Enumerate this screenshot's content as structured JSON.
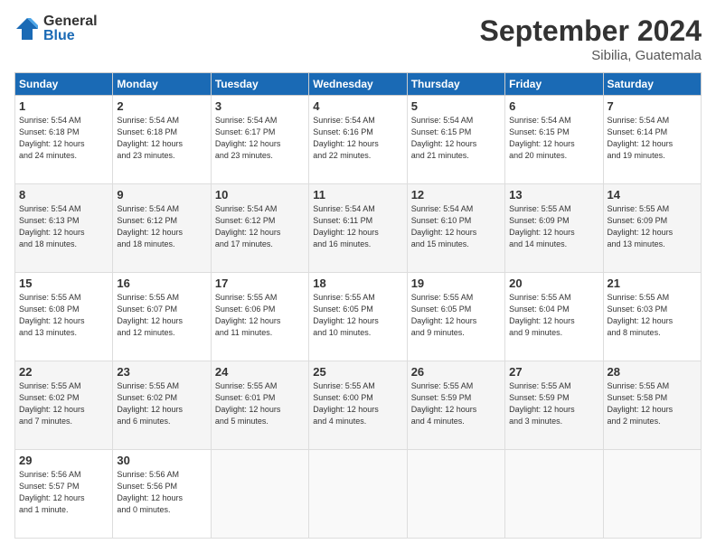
{
  "logo": {
    "general": "General",
    "blue": "Blue"
  },
  "title": "September 2024",
  "subtitle": "Sibilia, Guatemala",
  "days_header": [
    "Sunday",
    "Monday",
    "Tuesday",
    "Wednesday",
    "Thursday",
    "Friday",
    "Saturday"
  ],
  "weeks": [
    [
      {
        "day": "1",
        "info": "Sunrise: 5:54 AM\nSunset: 6:18 PM\nDaylight: 12 hours\nand 24 minutes."
      },
      {
        "day": "2",
        "info": "Sunrise: 5:54 AM\nSunset: 6:18 PM\nDaylight: 12 hours\nand 23 minutes."
      },
      {
        "day": "3",
        "info": "Sunrise: 5:54 AM\nSunset: 6:17 PM\nDaylight: 12 hours\nand 23 minutes."
      },
      {
        "day": "4",
        "info": "Sunrise: 5:54 AM\nSunset: 6:16 PM\nDaylight: 12 hours\nand 22 minutes."
      },
      {
        "day": "5",
        "info": "Sunrise: 5:54 AM\nSunset: 6:15 PM\nDaylight: 12 hours\nand 21 minutes."
      },
      {
        "day": "6",
        "info": "Sunrise: 5:54 AM\nSunset: 6:15 PM\nDaylight: 12 hours\nand 20 minutes."
      },
      {
        "day": "7",
        "info": "Sunrise: 5:54 AM\nSunset: 6:14 PM\nDaylight: 12 hours\nand 19 minutes."
      }
    ],
    [
      {
        "day": "8",
        "info": "Sunrise: 5:54 AM\nSunset: 6:13 PM\nDaylight: 12 hours\nand 18 minutes."
      },
      {
        "day": "9",
        "info": "Sunrise: 5:54 AM\nSunset: 6:12 PM\nDaylight: 12 hours\nand 18 minutes."
      },
      {
        "day": "10",
        "info": "Sunrise: 5:54 AM\nSunset: 6:12 PM\nDaylight: 12 hours\nand 17 minutes."
      },
      {
        "day": "11",
        "info": "Sunrise: 5:54 AM\nSunset: 6:11 PM\nDaylight: 12 hours\nand 16 minutes."
      },
      {
        "day": "12",
        "info": "Sunrise: 5:54 AM\nSunset: 6:10 PM\nDaylight: 12 hours\nand 15 minutes."
      },
      {
        "day": "13",
        "info": "Sunrise: 5:55 AM\nSunset: 6:09 PM\nDaylight: 12 hours\nand 14 minutes."
      },
      {
        "day": "14",
        "info": "Sunrise: 5:55 AM\nSunset: 6:09 PM\nDaylight: 12 hours\nand 13 minutes."
      }
    ],
    [
      {
        "day": "15",
        "info": "Sunrise: 5:55 AM\nSunset: 6:08 PM\nDaylight: 12 hours\nand 13 minutes."
      },
      {
        "day": "16",
        "info": "Sunrise: 5:55 AM\nSunset: 6:07 PM\nDaylight: 12 hours\nand 12 minutes."
      },
      {
        "day": "17",
        "info": "Sunrise: 5:55 AM\nSunset: 6:06 PM\nDaylight: 12 hours\nand 11 minutes."
      },
      {
        "day": "18",
        "info": "Sunrise: 5:55 AM\nSunset: 6:05 PM\nDaylight: 12 hours\nand 10 minutes."
      },
      {
        "day": "19",
        "info": "Sunrise: 5:55 AM\nSunset: 6:05 PM\nDaylight: 12 hours\nand 9 minutes."
      },
      {
        "day": "20",
        "info": "Sunrise: 5:55 AM\nSunset: 6:04 PM\nDaylight: 12 hours\nand 9 minutes."
      },
      {
        "day": "21",
        "info": "Sunrise: 5:55 AM\nSunset: 6:03 PM\nDaylight: 12 hours\nand 8 minutes."
      }
    ],
    [
      {
        "day": "22",
        "info": "Sunrise: 5:55 AM\nSunset: 6:02 PM\nDaylight: 12 hours\nand 7 minutes."
      },
      {
        "day": "23",
        "info": "Sunrise: 5:55 AM\nSunset: 6:02 PM\nDaylight: 12 hours\nand 6 minutes."
      },
      {
        "day": "24",
        "info": "Sunrise: 5:55 AM\nSunset: 6:01 PM\nDaylight: 12 hours\nand 5 minutes."
      },
      {
        "day": "25",
        "info": "Sunrise: 5:55 AM\nSunset: 6:00 PM\nDaylight: 12 hours\nand 4 minutes."
      },
      {
        "day": "26",
        "info": "Sunrise: 5:55 AM\nSunset: 5:59 PM\nDaylight: 12 hours\nand 4 minutes."
      },
      {
        "day": "27",
        "info": "Sunrise: 5:55 AM\nSunset: 5:59 PM\nDaylight: 12 hours\nand 3 minutes."
      },
      {
        "day": "28",
        "info": "Sunrise: 5:55 AM\nSunset: 5:58 PM\nDaylight: 12 hours\nand 2 minutes."
      }
    ],
    [
      {
        "day": "29",
        "info": "Sunrise: 5:56 AM\nSunset: 5:57 PM\nDaylight: 12 hours\nand 1 minute."
      },
      {
        "day": "30",
        "info": "Sunrise: 5:56 AM\nSunset: 5:56 PM\nDaylight: 12 hours\nand 0 minutes."
      },
      {
        "day": "",
        "info": ""
      },
      {
        "day": "",
        "info": ""
      },
      {
        "day": "",
        "info": ""
      },
      {
        "day": "",
        "info": ""
      },
      {
        "day": "",
        "info": ""
      }
    ]
  ]
}
